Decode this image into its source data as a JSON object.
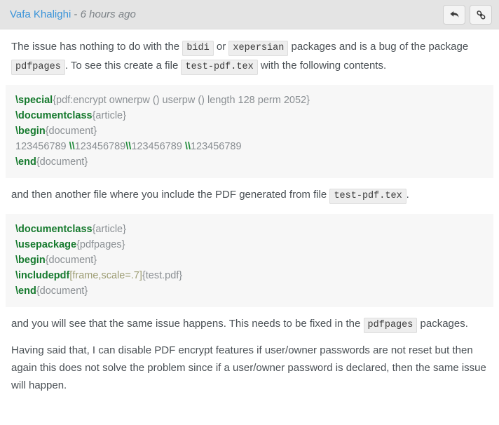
{
  "post": {
    "author": "Vafa Khalighi",
    "byline_separator": " - ",
    "timestamp": "6 hours ago",
    "accent_color": "#3b94d9",
    "header_bg": "#e4e4e4",
    "code_bg": "#f7f7f7",
    "command_color": "#167a2e"
  },
  "actions": [
    {
      "name": "reply-button",
      "icon": "reply-arrow-icon",
      "label": ""
    },
    {
      "name": "link-button",
      "icon": "chain-link-icon",
      "label": ""
    }
  ],
  "paragraphs": {
    "p1_a": "The issue has nothing to do with the ",
    "p1_code1": "bidi",
    "p1_b": " or ",
    "p1_code2": "xepersian",
    "p1_c": " packages and is a bug of the package ",
    "p1_code3": "pdfpages",
    "p1_d": ". To see this create a file ",
    "p1_code4": "test-pdf.tex",
    "p1_e": " with the following contents.",
    "p2_a": "and then another file where you include the PDF generated from file ",
    "p2_code1": "test-pdf.tex",
    "p2_b": ".",
    "p3_a": "and you will see that the same issue happens. This needs to be fixed in the ",
    "p3_code1": "pdfpages",
    "p3_b": " packages.",
    "p4": "Having said that, I can disable PDF encrypt features if user/owner passwords are not reset but then again this does not solve the problem since if a user/owner password is declared, then the same issue will happen."
  },
  "code_block_1": {
    "lines": [
      {
        "cmd": "\\special",
        "arg": "{pdf:encrypt ownerpw () userpw () length 128 perm 2052}"
      },
      {
        "cmd": "\\documentclass",
        "arg": "{article}"
      },
      {
        "cmd": "\\begin",
        "arg": "{document}"
      },
      {
        "plain": "123456789 ",
        "brk1": "\\\\",
        "plain2": "123456789",
        "brk2": "\\\\",
        "plain3": "123456789 ",
        "brk3": "\\\\",
        "plain4": "123456789"
      },
      {
        "cmd": "\\end",
        "arg": "{document}"
      }
    ],
    "line1_cmd": "\\special",
    "line1_arg": "{pdf:encrypt ownerpw () userpw () length 128 perm 2052}",
    "line2_cmd": "\\documentclass",
    "line2_arg": "{article}",
    "line3_cmd": "\\begin",
    "line3_arg": "{document}",
    "line4_t1": "123456789 ",
    "line4_b1": "\\\\",
    "line4_t2": "123456789",
    "line4_b2": "\\\\",
    "line4_t3": "123456789 ",
    "line4_b3": "\\\\",
    "line4_t4": "123456789",
    "line5_cmd": "\\end",
    "line5_arg": "{document}"
  },
  "code_block_2": {
    "line1_cmd": "\\documentclass",
    "line1_arg": "{article}",
    "line2_cmd": "\\usepackage",
    "line2_arg": "{pdfpages}",
    "line3_cmd": "\\begin",
    "line3_arg": "{document}",
    "line4_cmd": "\\includepdf",
    "line4_opt": "[frame,scale=.7]",
    "line4_arg": "{test.pdf}",
    "line5_cmd": "\\end",
    "line5_arg": "{document}"
  }
}
